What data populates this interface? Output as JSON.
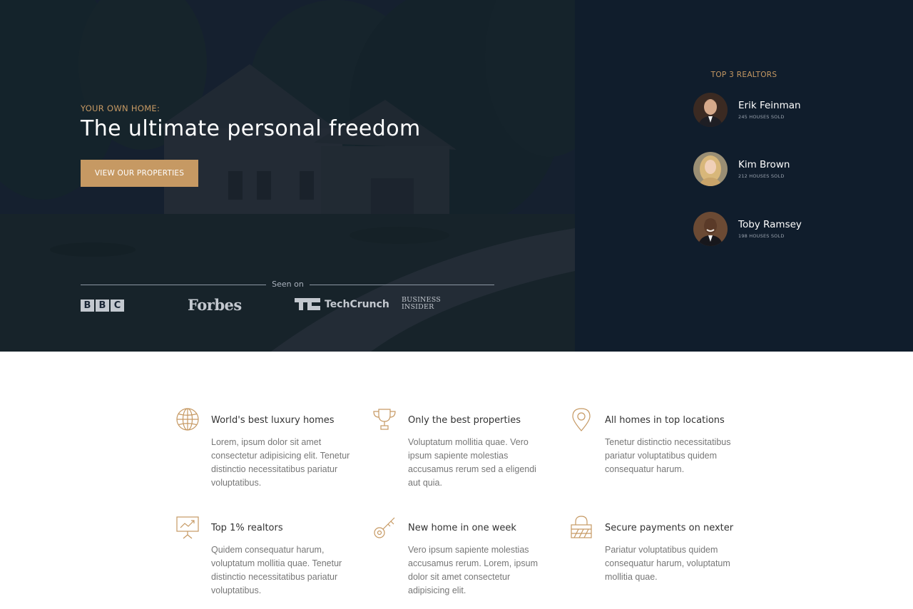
{
  "hero": {
    "eyebrow": "YOUR OWN HOME:",
    "title": "The ultimate personal freedom",
    "cta_label": "VIEW OUR PROPERTIES",
    "seen_on_label": "Seen on",
    "logos": {
      "bbc": [
        "B",
        "B",
        "C"
      ],
      "forbes": "Forbes",
      "techcrunch": "TechCrunch",
      "business_insider_line1": "BUSINESS",
      "business_insider_line2": "INSIDER"
    }
  },
  "realtors": {
    "title": "TOP 3 REALTORS",
    "items": [
      {
        "name": "Erik Feinman",
        "sold": "245 HOUSES SOLD"
      },
      {
        "name": "Kim Brown",
        "sold": "212 HOUSES SOLD"
      },
      {
        "name": "Toby Ramsey",
        "sold": "198 HOUSES SOLD"
      }
    ]
  },
  "features": [
    {
      "icon": "globe-icon",
      "title": "World's best luxury homes",
      "text": "Lorem, ipsum dolor sit amet consectetur adipisicing elit. Tenetur distinctio necessitatibus pariatur voluptatibus."
    },
    {
      "icon": "trophy-icon",
      "title": "Only the best properties",
      "text": "Voluptatum mollitia quae. Vero ipsum sapiente molestias accusamus rerum sed a eligendi aut quia."
    },
    {
      "icon": "map-pin-icon",
      "title": "All homes in top locations",
      "text": "Tenetur distinctio necessitatibus pariatur voluptatibus quidem consequatur harum."
    },
    {
      "icon": "presentation-chart-icon",
      "title": "Top 1% realtors",
      "text": "Quidem consequatur harum, voluptatum mollitia quae. Tenetur distinctio necessitatibus pariatur voluptatibus."
    },
    {
      "icon": "key-icon",
      "title": "New home in one week",
      "text": "Vero ipsum sapiente molestias accusamus rerum. Lorem, ipsum dolor sit amet consectetur adipisicing elit."
    },
    {
      "icon": "lock-icon",
      "title": "Secure payments on nexter",
      "text": "Pariatur voluptatibus quidem consequatur harum, voluptatum mollitia quae."
    }
  ],
  "colors": {
    "accent": "#c69963",
    "panel": "#101d2c",
    "hero_overlay": "#1a2636"
  }
}
